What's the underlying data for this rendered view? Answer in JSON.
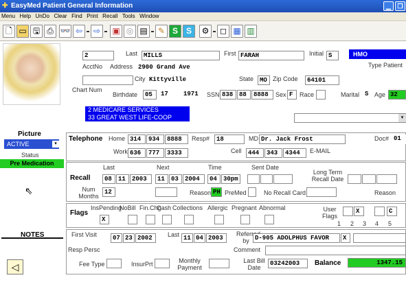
{
  "window": {
    "title": "EasyMed Patient General Information"
  },
  "menu": [
    "Menu",
    "Help",
    "UnDo",
    "Clear",
    "Find",
    "Print",
    "Recall",
    "Tools",
    "Window"
  ],
  "toolbar": {
    "icons": [
      "new-document-icon",
      "folder-icon",
      "save-icon",
      "print-icon",
      "binoculars-icon",
      "back-arrow-icon",
      "forward-arrow-icon",
      "gift-icon",
      "coin-icon",
      "calculator-icon",
      "pen-icon",
      "s-icon",
      "s-icon",
      "wrench-icon",
      "window-icon",
      "grid-icon",
      "spreadsheet-icon"
    ]
  },
  "patient": {
    "id": "2",
    "last_label": "Last",
    "last": "MILLS",
    "first_label": "First",
    "first": "FARAH",
    "initial_label": "Initial",
    "initial": "S",
    "plan": "HMO",
    "type_label": "Type Patient",
    "acctno_label": "AcctNo",
    "address_label": "Address",
    "address": "2900 Grand Ave",
    "city_label": "City",
    "city": "Kittyville",
    "state_label": "State",
    "state": "MO",
    "zip_label": "Zip Code",
    "zip": "64101",
    "chart_label": "Chart Num",
    "birthdate_label": "Birthdate",
    "birth_m": "05",
    "birth_d": "17",
    "birth_y": "1971",
    "ssn_label": "SSN",
    "ssn1": "838",
    "ssn2": "88",
    "ssn3": "8888",
    "sex_label": "Sex",
    "sex": "F",
    "race_label": "Race",
    "marital_label": "Marital",
    "marital": "S",
    "age_label": "Age",
    "age": "32"
  },
  "insurance": [
    "2 MEDICARE SERVICES",
    "33 GREAT WEST LIFE-COOP"
  ],
  "left": {
    "picture_label": "Picture",
    "status_value": "ACTIVE",
    "status_label": "Status",
    "premed_label": "Pre Medication",
    "notes_label": "NOTES"
  },
  "telephone": {
    "header": "Telephone",
    "home_label": "Home",
    "home1": "314",
    "home2": "934",
    "home3": "8888",
    "resp_label": "Resp#",
    "resp": "18",
    "md_label": "MD",
    "md": "Dr. Jack Frost",
    "doc_label": "Doc#",
    "doc": "01",
    "work_label": "Work",
    "work1": "636",
    "work2": "777",
    "work3": "3333",
    "cell_label": "Cell",
    "cell1": "444",
    "cell2": "343",
    "cell3": "4344",
    "email_label": "E-MAIL"
  },
  "recall": {
    "header": "Recall",
    "last_label": "Last",
    "next_label": "Next",
    "time_label": "Time",
    "sent_label": "Sent Date",
    "longterm_label": "Long Term Recall Date",
    "last_m": "08",
    "last_d": "11",
    "last_y": "2003",
    "next_m": "11",
    "next_d": "03",
    "next_y": "2004",
    "time_h": "04",
    "time_v": "30pm",
    "num_label": "Num Months",
    "num": "12",
    "reason_label": "Reason",
    "reason_code": "PH",
    "premed_label": "PreMed",
    "norecall_label": "No Recall Card",
    "reason2_label": "Reason"
  },
  "flags": {
    "header": "Flags",
    "labels": [
      "InsPending",
      "NoBill",
      "Fin.Chg",
      "Cash",
      "Collections",
      "Allergic",
      "Pregnant",
      "Abnormal"
    ],
    "values": [
      "X",
      "",
      "",
      "",
      "",
      "",
      "",
      ""
    ],
    "user_label": "User Flags",
    "user_values": [
      "",
      "X",
      "",
      "C"
    ],
    "user_nums": [
      "1",
      "2",
      "3",
      "4",
      "5"
    ]
  },
  "visit": {
    "first_label": "First Visit",
    "first_m": "07",
    "first_d": "23",
    "first_y": "2002",
    "last_label": "Last",
    "last_m": "11",
    "last_d": "04",
    "last_y": "2003",
    "referred_label": "Referred by",
    "referred": "D-905 ADOLPHUS FAVOR",
    "referred_flag": "X",
    "resp_person_label": "Resp Person",
    "comment_label": "Comment",
    "fee_label": "Fee Type",
    "insur_label": "InsurPrt",
    "monthly_label": "Monthly Payment",
    "lastbill_label": "Last Bill Date",
    "lastbill": "03242003",
    "balance_label": "Balance",
    "balance": "1347.15"
  }
}
